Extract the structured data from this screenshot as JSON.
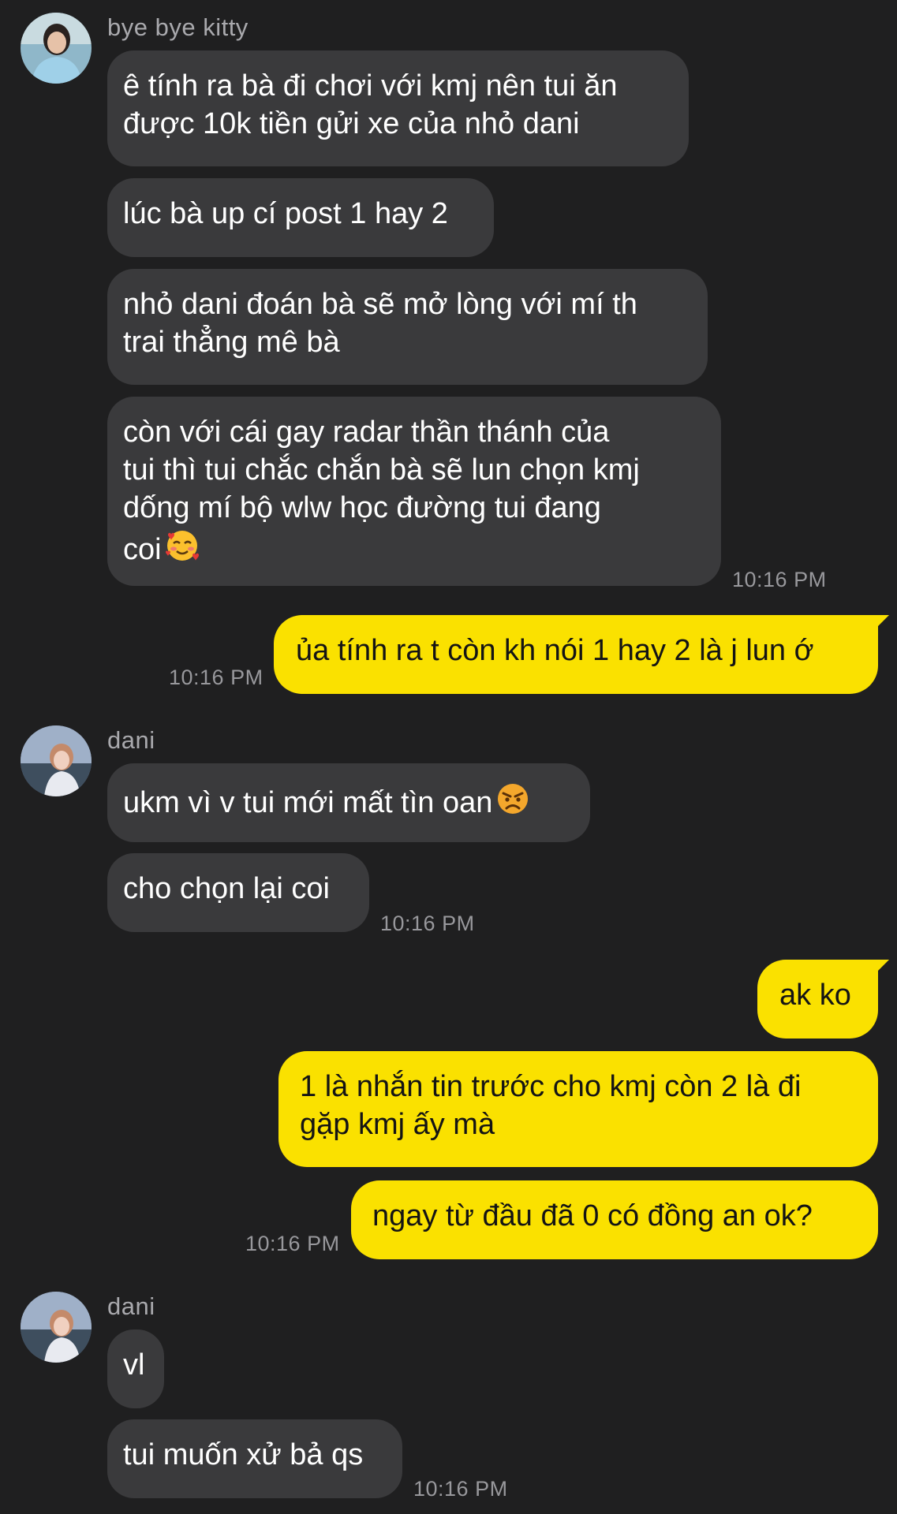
{
  "messages": [
    {
      "sender": "bye bye kitty"
    },
    {
      "text_1": "ê tính ra bà đi chơi với kmj nên tui ăn",
      "text_2": "được 10k tiền gửi xe của nhỏ dani"
    },
    {
      "text": "lúc bà up cí post 1 hay 2"
    },
    {
      "text_1": "nhỏ dani đoán bà sẽ mở lòng với mí th",
      "text_2": "trai thẳng mê bà"
    },
    {
      "text_1": "còn với cái gay radar thần thánh của",
      "text_2": "tui thì tui chắc chắn bà sẽ lun chọn kmj",
      "text_3": "dống mí bộ wlw học đường tui đang",
      "text_4": "coi",
      "time": "10:16 PM"
    },
    {
      "text": "ủa tính ra t còn kh nói 1 hay 2 là j lun ớ",
      "time": "10:16 PM"
    },
    {
      "sender": "dani",
      "text": "ukm vì v tui mới mất tìn oan"
    },
    {
      "text": "cho chọn lại coi",
      "time": "10:16 PM"
    },
    {
      "text": "ak ko"
    },
    {
      "text_1": "1 là nhắn tin trước cho kmj còn 2 là đi",
      "text_2": "gặp kmj ấy mà"
    },
    {
      "text": "ngay từ đầu đã 0 có đồng an ok?",
      "time": "10:16 PM"
    },
    {
      "sender": "dani",
      "text": "vl"
    },
    {
      "text": "tui muốn xử bả qs",
      "time": "10:16 PM"
    }
  ],
  "icons": {
    "emoji_1": "smiling-face-with-hearts-icon",
    "emoji_2": "angry-face-icon",
    "avatar_1": "avatar-girl-blue-shirt",
    "avatar_2": "avatar-dani"
  },
  "colors": {
    "background": "#1f1f20",
    "incoming_bubble": "#3a3a3c",
    "outgoing_bubble": "#fae100"
  }
}
